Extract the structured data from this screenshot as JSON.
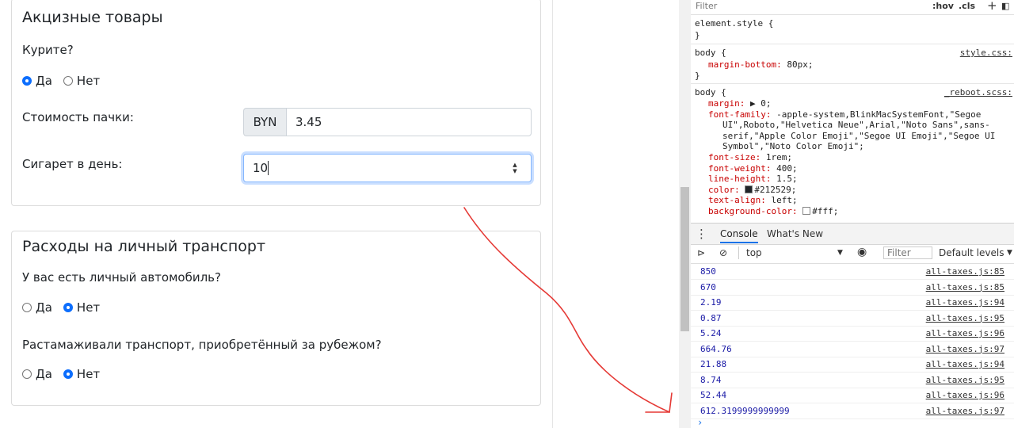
{
  "card1": {
    "title": "Акцизные товары",
    "question": "Курите?",
    "yes": "Да",
    "no": "Нет",
    "pack_label": "Стоимость пачки:",
    "currency": "BYN",
    "pack_value": "3.45",
    "cig_label": "Сигарет в день:",
    "cig_value": "10"
  },
  "card2": {
    "title": "Расходы на личный транспорт",
    "q1": "У вас есть личный автомобиль?",
    "q2": "Растамаживали транспорт, приобретённый за рубежом?",
    "yes": "Да",
    "no": "Нет"
  },
  "devtools": {
    "filter_placeholder": "Filter",
    "hov": ":hov",
    "cls": ".cls",
    "rule1": {
      "selector": "element.style {",
      "close": "}"
    },
    "rule2": {
      "selector": "body {",
      "source": "style.css:",
      "prop": "margin-bottom",
      "value": "80px;",
      "close": "}"
    },
    "rule3": {
      "selector": "body {",
      "source": "_reboot.scss:",
      "props": [
        {
          "name": "margin",
          "value": "▶ 0;"
        },
        {
          "name": "font-family",
          "value": "-apple-system,BlinkMacSystemFont,\"Segoe"
        },
        {
          "name": "",
          "value": "UI\",Roboto,\"Helvetica Neue\",Arial,\"Noto Sans\",sans-"
        },
        {
          "name": "",
          "value": "serif,\"Apple Color Emoji\",\"Segoe UI Emoji\",\"Segoe UI"
        },
        {
          "name": "",
          "value": "Symbol\",\"Noto Color Emoji\";"
        },
        {
          "name": "font-size",
          "value": "1rem;"
        },
        {
          "name": "font-weight",
          "value": "400;"
        },
        {
          "name": "line-height",
          "value": "1.5;"
        },
        {
          "name": "color",
          "value": "#212529;"
        },
        {
          "name": "text-align",
          "value": "left;"
        },
        {
          "name": "background-color",
          "value": "#fff;"
        }
      ]
    },
    "tabs": {
      "console": "Console",
      "whats_new": "What's New"
    },
    "toolbar": {
      "context": "top",
      "filter_placeholder": "Filter",
      "levels": "Default levels"
    },
    "logs": [
      {
        "value": "850",
        "loc": "all-taxes.js:85"
      },
      {
        "value": "670",
        "loc": "all-taxes.js:85"
      },
      {
        "value": "2.19",
        "loc": "all-taxes.js:94"
      },
      {
        "value": "0.87",
        "loc": "all-taxes.js:95"
      },
      {
        "value": "5.24",
        "loc": "all-taxes.js:96"
      },
      {
        "value": "664.76",
        "loc": "all-taxes.js:97"
      },
      {
        "value": "21.88",
        "loc": "all-taxes.js:94"
      },
      {
        "value": "8.74",
        "loc": "all-taxes.js:95"
      },
      {
        "value": "52.44",
        "loc": "all-taxes.js:96"
      },
      {
        "value": "612.3199999999999",
        "loc": "all-taxes.js:97"
      }
    ],
    "prompt": "›"
  },
  "colors": {
    "accent": "#0d6efd",
    "annotation": "#e53935",
    "console_number": "#1a1aa6"
  }
}
